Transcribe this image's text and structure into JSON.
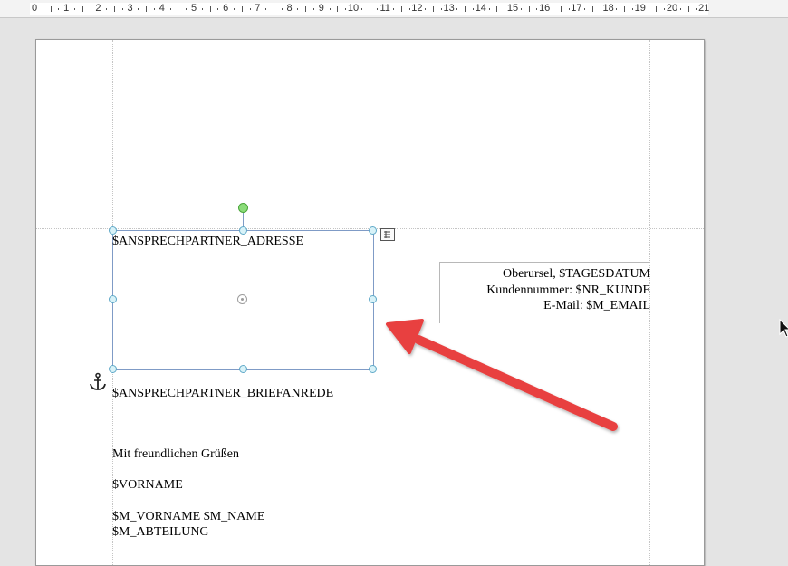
{
  "ruler": {
    "labels": [
      "0",
      "1",
      "2",
      "3",
      "4",
      "5",
      "6",
      "7",
      "8",
      "9",
      "10",
      "11",
      "12",
      "13",
      "14",
      "15",
      "16",
      "17",
      "18",
      "19",
      "20",
      "21"
    ]
  },
  "document": {
    "address_field": "$ANSPRECHPARTNER_ADRESSE",
    "info_block": {
      "line1": "Oberursel, $TAGESDATUM",
      "line2": "Kundennummer: $NR_KUNDE",
      "line3": "E-Mail: $M_EMAIL"
    },
    "salutation": "$ANSPRECHPARTNER_BRIEFANREDE",
    "closing": "Mit freundlichen Grüßen",
    "firstname": "$VORNAME",
    "signature_name": "$M_VORNAME $M_NAME",
    "department": "$M_ABTEILUNG"
  },
  "annotation": {
    "arrow_color": "#e8403f"
  },
  "icons": {
    "anchor": "anchor-icon",
    "textframe": "text-frame-icon",
    "cursor": "mouse-cursor-icon"
  }
}
